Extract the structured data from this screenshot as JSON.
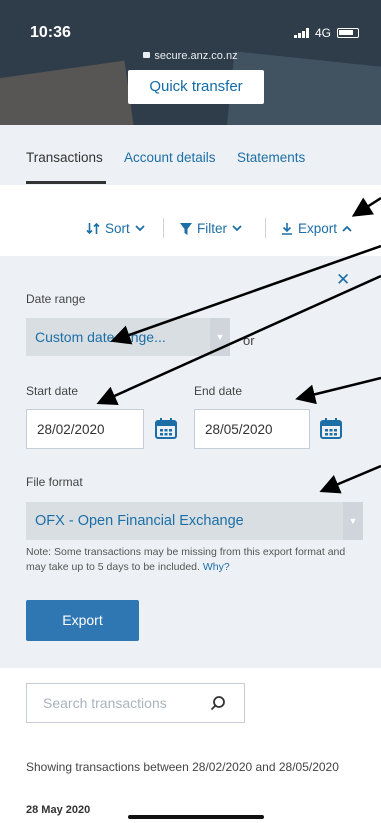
{
  "status_bar": {
    "time": "10:36",
    "network": "4G"
  },
  "browser": {
    "url": "secure.anz.co.nz"
  },
  "header": {
    "quick_transfer": "Quick transfer"
  },
  "tabs": [
    {
      "label": "Transactions",
      "active": true
    },
    {
      "label": "Account details",
      "active": false
    },
    {
      "label": "Statements",
      "active": false
    }
  ],
  "toolbar": {
    "sort": "Sort",
    "filter": "Filter",
    "export": "Export"
  },
  "export_panel": {
    "date_range_label": "Date range",
    "date_range_value": "Custom date range...",
    "or": "or",
    "start_label": "Start date",
    "start_value": "28/02/2020",
    "end_label": "End date",
    "end_value": "28/05/2020",
    "format_label": "File format",
    "format_value": "OFX - Open Financial Exchange",
    "note": "Note: Some transactions may be missing from this export format and may take up to 5 days to be included.",
    "note_link": "Why?",
    "export_button": "Export"
  },
  "search": {
    "placeholder": "Search transactions"
  },
  "results": {
    "showing": "Showing transactions between 28/02/2020 and 28/05/2020",
    "first_day": "28 May 2020"
  },
  "colors": {
    "link": "#1c6fa6",
    "panel": "#edf1f5",
    "button": "#2e77b3"
  }
}
